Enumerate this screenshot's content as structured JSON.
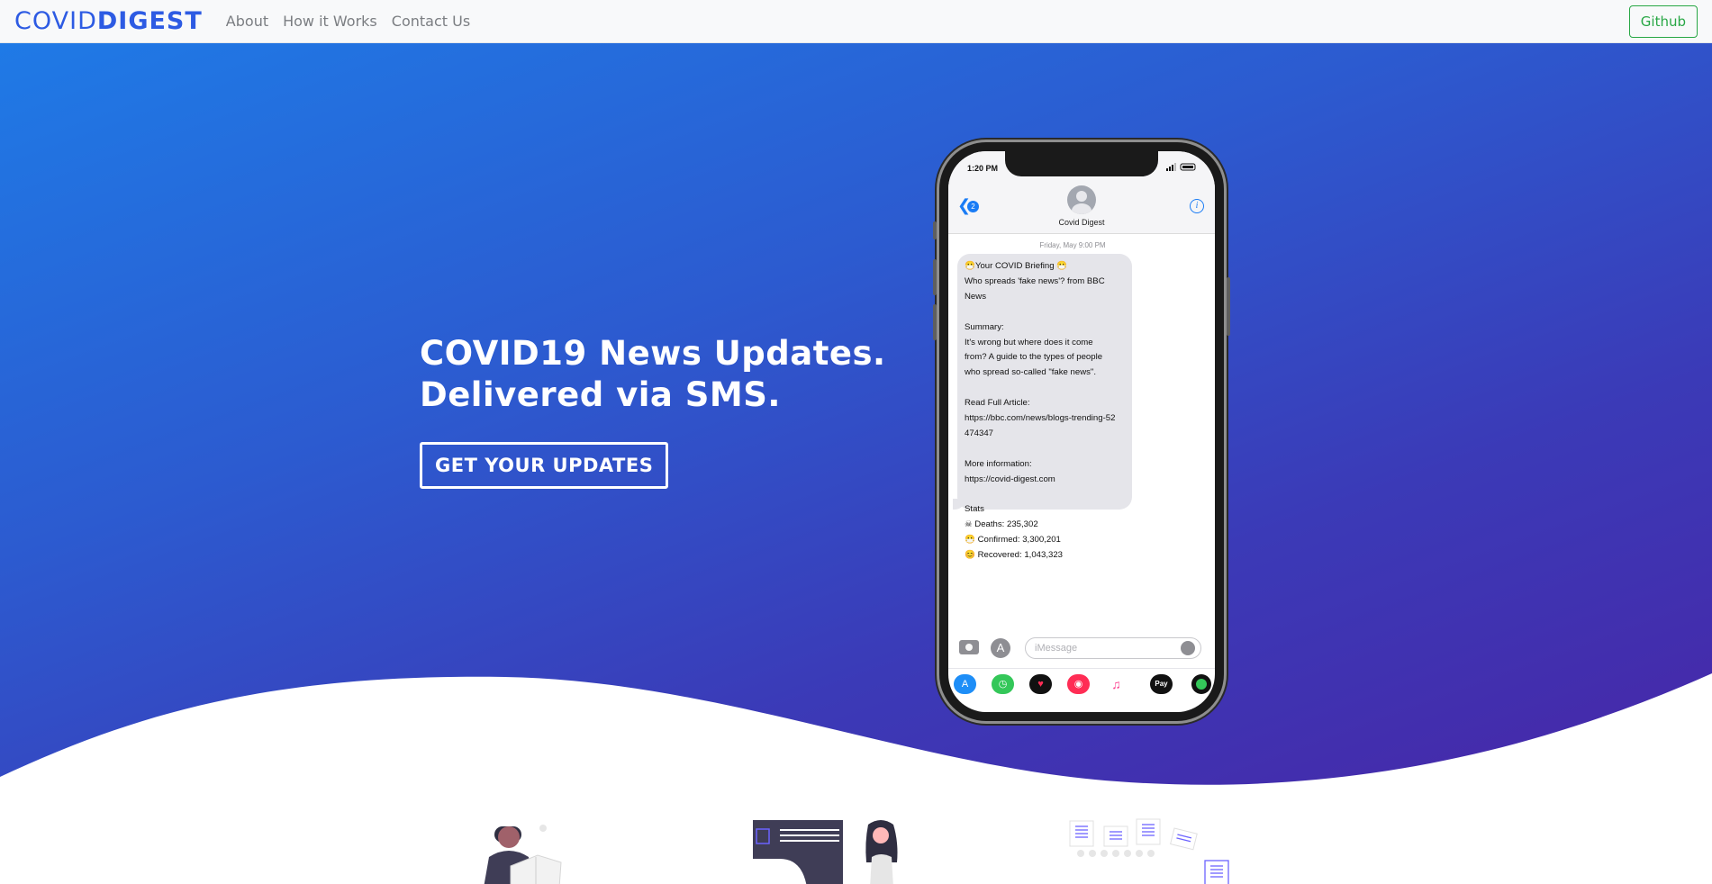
{
  "navbar": {
    "brand_part1": "COVID",
    "brand_part2": "DIGEST",
    "links": [
      "About",
      "How it Works",
      "Contact Us"
    ],
    "github_label": "Github"
  },
  "hero": {
    "headline_line1": "COVID19 News Updates.",
    "headline_line2": "Delivered via SMS.",
    "cta_label": "GET YOUR UPDATES",
    "gradient_start": "#1f7ae6",
    "gradient_end": "#4a22a4"
  },
  "phone": {
    "status_time": "1:20 PM",
    "back_count": "2",
    "contact_name": "Covid Digest",
    "message_date": "Friday, May 9:00 PM",
    "message_lines": [
      "😷Your COVID Briefing 😷",
      "Who spreads 'fake news'? from BBC",
      "News",
      "",
      "Summary:",
      "It's wrong but where does it come",
      "from? A guide to the types of people",
      "who spread so-called \"fake news\".",
      "",
      "Read Full Article:",
      "https://bbc.com/news/blogs-trending-52",
      "474347",
      "",
      "More information:",
      "https://covid-digest.com",
      "",
      "Stats",
      "☠ Deaths: 235,302",
      "😷 Confirmed: 3,300,201",
      "😊 Recovered: 1,043,323"
    ],
    "input_placeholder": "iMessage",
    "apple_pay_label": "Pay",
    "app_icons": [
      "app-store",
      "activity",
      "heart-touch",
      "search-images",
      "music",
      "apple-pay",
      "green-app"
    ]
  }
}
